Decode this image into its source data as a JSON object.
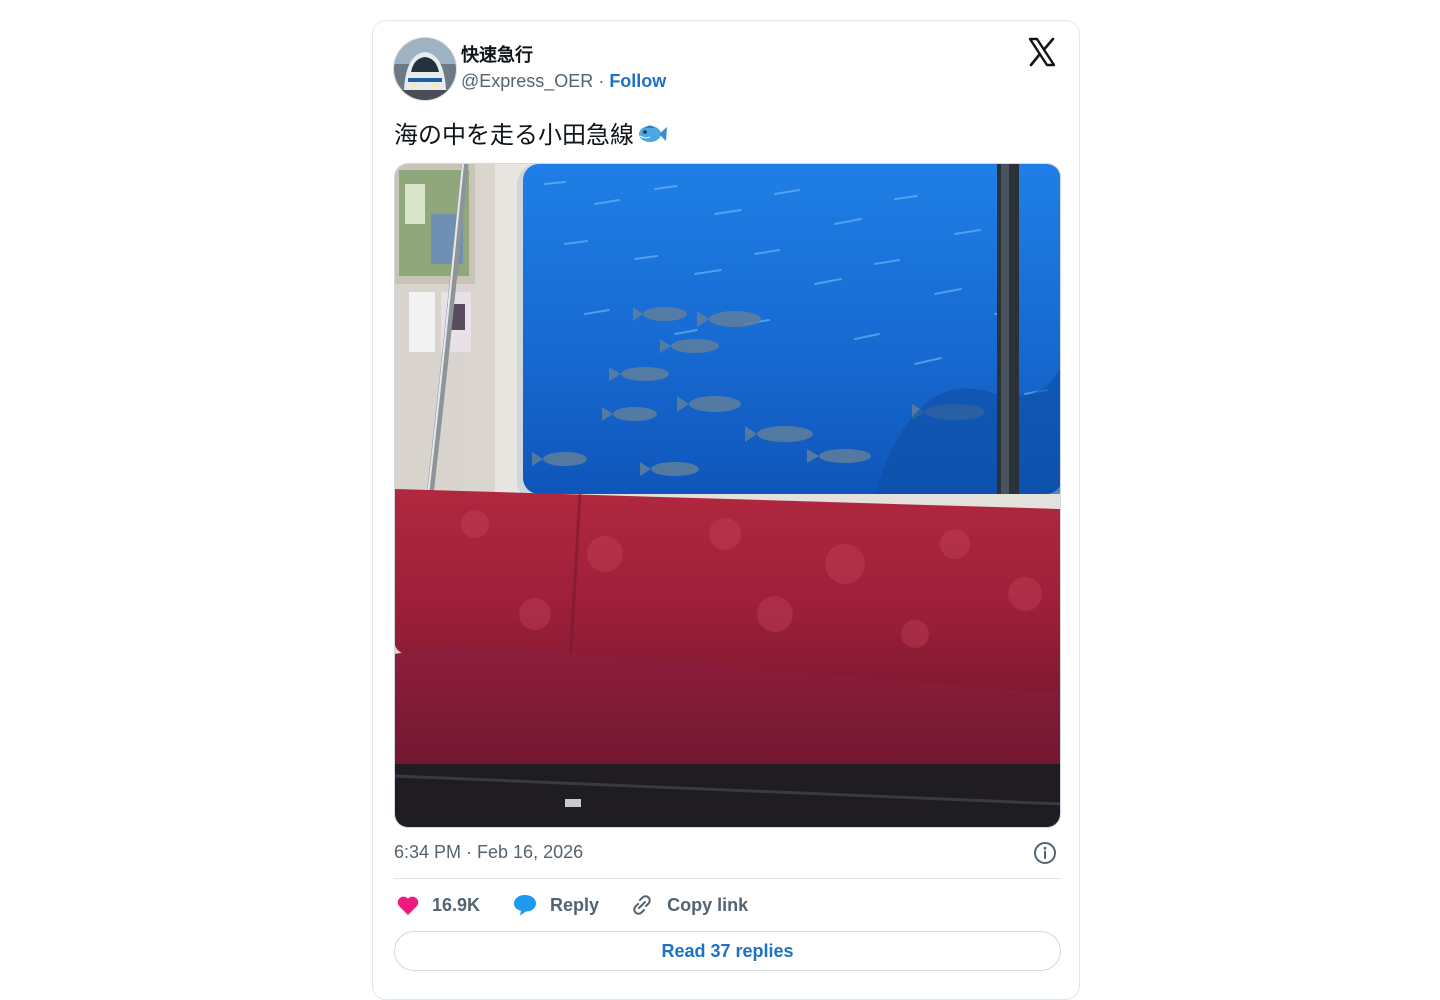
{
  "author": {
    "display_name": "快速急行",
    "handle": "@Express_OER",
    "separator": " · ",
    "follow_label": "Follow"
  },
  "tweet": {
    "text": "海の中を走る小田急線",
    "emoji": "fish-icon",
    "timestamp": "6:34 PM · Feb 16, 2026"
  },
  "actions": {
    "likes": "16.9K",
    "reply_label": "Reply",
    "copy_link_label": "Copy link"
  },
  "read_replies_label": "Read 37 replies",
  "colors": {
    "accent": "#1d72c4",
    "like": "#f0197d",
    "reply": "#1d9bf0",
    "muted": "#536471"
  }
}
